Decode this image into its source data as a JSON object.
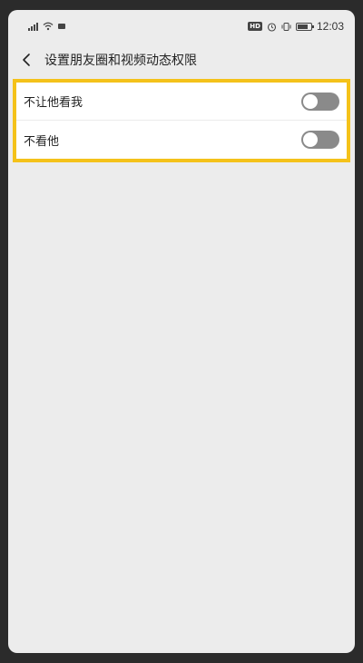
{
  "status_bar": {
    "hd_label": "HD",
    "time": "12:03",
    "battery_level": 0.8
  },
  "header": {
    "title": "设置朋友圈和视频动态权限"
  },
  "settings": [
    {
      "label": "不让他看我",
      "enabled": false
    },
    {
      "label": "不看他",
      "enabled": false
    }
  ],
  "colors": {
    "highlight_border": "#f4c21a",
    "toggle_off": "#8a8a8a",
    "background": "#ececec"
  },
  "icons": {
    "back": "chevron-left-icon",
    "signal": "signal-icon",
    "wifi": "wifi-icon",
    "alarm": "alarm-icon",
    "mute": "vibrate-icon",
    "battery": "battery-icon"
  }
}
